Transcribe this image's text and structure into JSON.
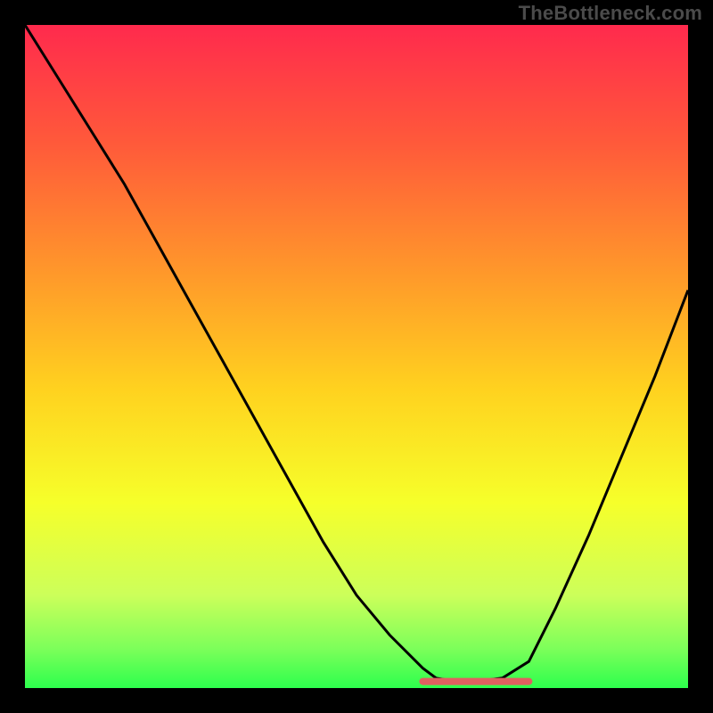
{
  "watermark": "TheBottleneck.com",
  "chart_data": {
    "type": "line",
    "title": "",
    "xlabel": "",
    "ylabel": "",
    "xlim": [
      0,
      100
    ],
    "ylim": [
      0,
      100
    ],
    "grid": false,
    "series": [
      {
        "name": "curve",
        "x": [
          0,
          5,
          10,
          15,
          20,
          25,
          30,
          35,
          40,
          45,
          50,
          55,
          60,
          62,
          65,
          68,
          72,
          76,
          80,
          85,
          90,
          95,
          100
        ],
        "y": [
          100,
          92,
          84,
          76,
          67,
          58,
          49,
          40,
          31,
          22,
          14,
          8,
          3,
          1.5,
          1.0,
          1.0,
          1.5,
          4,
          12,
          23,
          35,
          47,
          60
        ]
      }
    ],
    "flat_region": {
      "x_start": 60,
      "x_end": 76,
      "y": 1.0,
      "stroke": "#e06060"
    },
    "gradient_stops": [
      {
        "offset": 0.0,
        "color": "#ff2a4d"
      },
      {
        "offset": 0.18,
        "color": "#ff5a3a"
      },
      {
        "offset": 0.38,
        "color": "#ff9a2a"
      },
      {
        "offset": 0.55,
        "color": "#ffd21f"
      },
      {
        "offset": 0.72,
        "color": "#f6ff2a"
      },
      {
        "offset": 0.86,
        "color": "#ccff5a"
      },
      {
        "offset": 0.94,
        "color": "#7dff5a"
      },
      {
        "offset": 1.0,
        "color": "#2dff4d"
      }
    ]
  }
}
